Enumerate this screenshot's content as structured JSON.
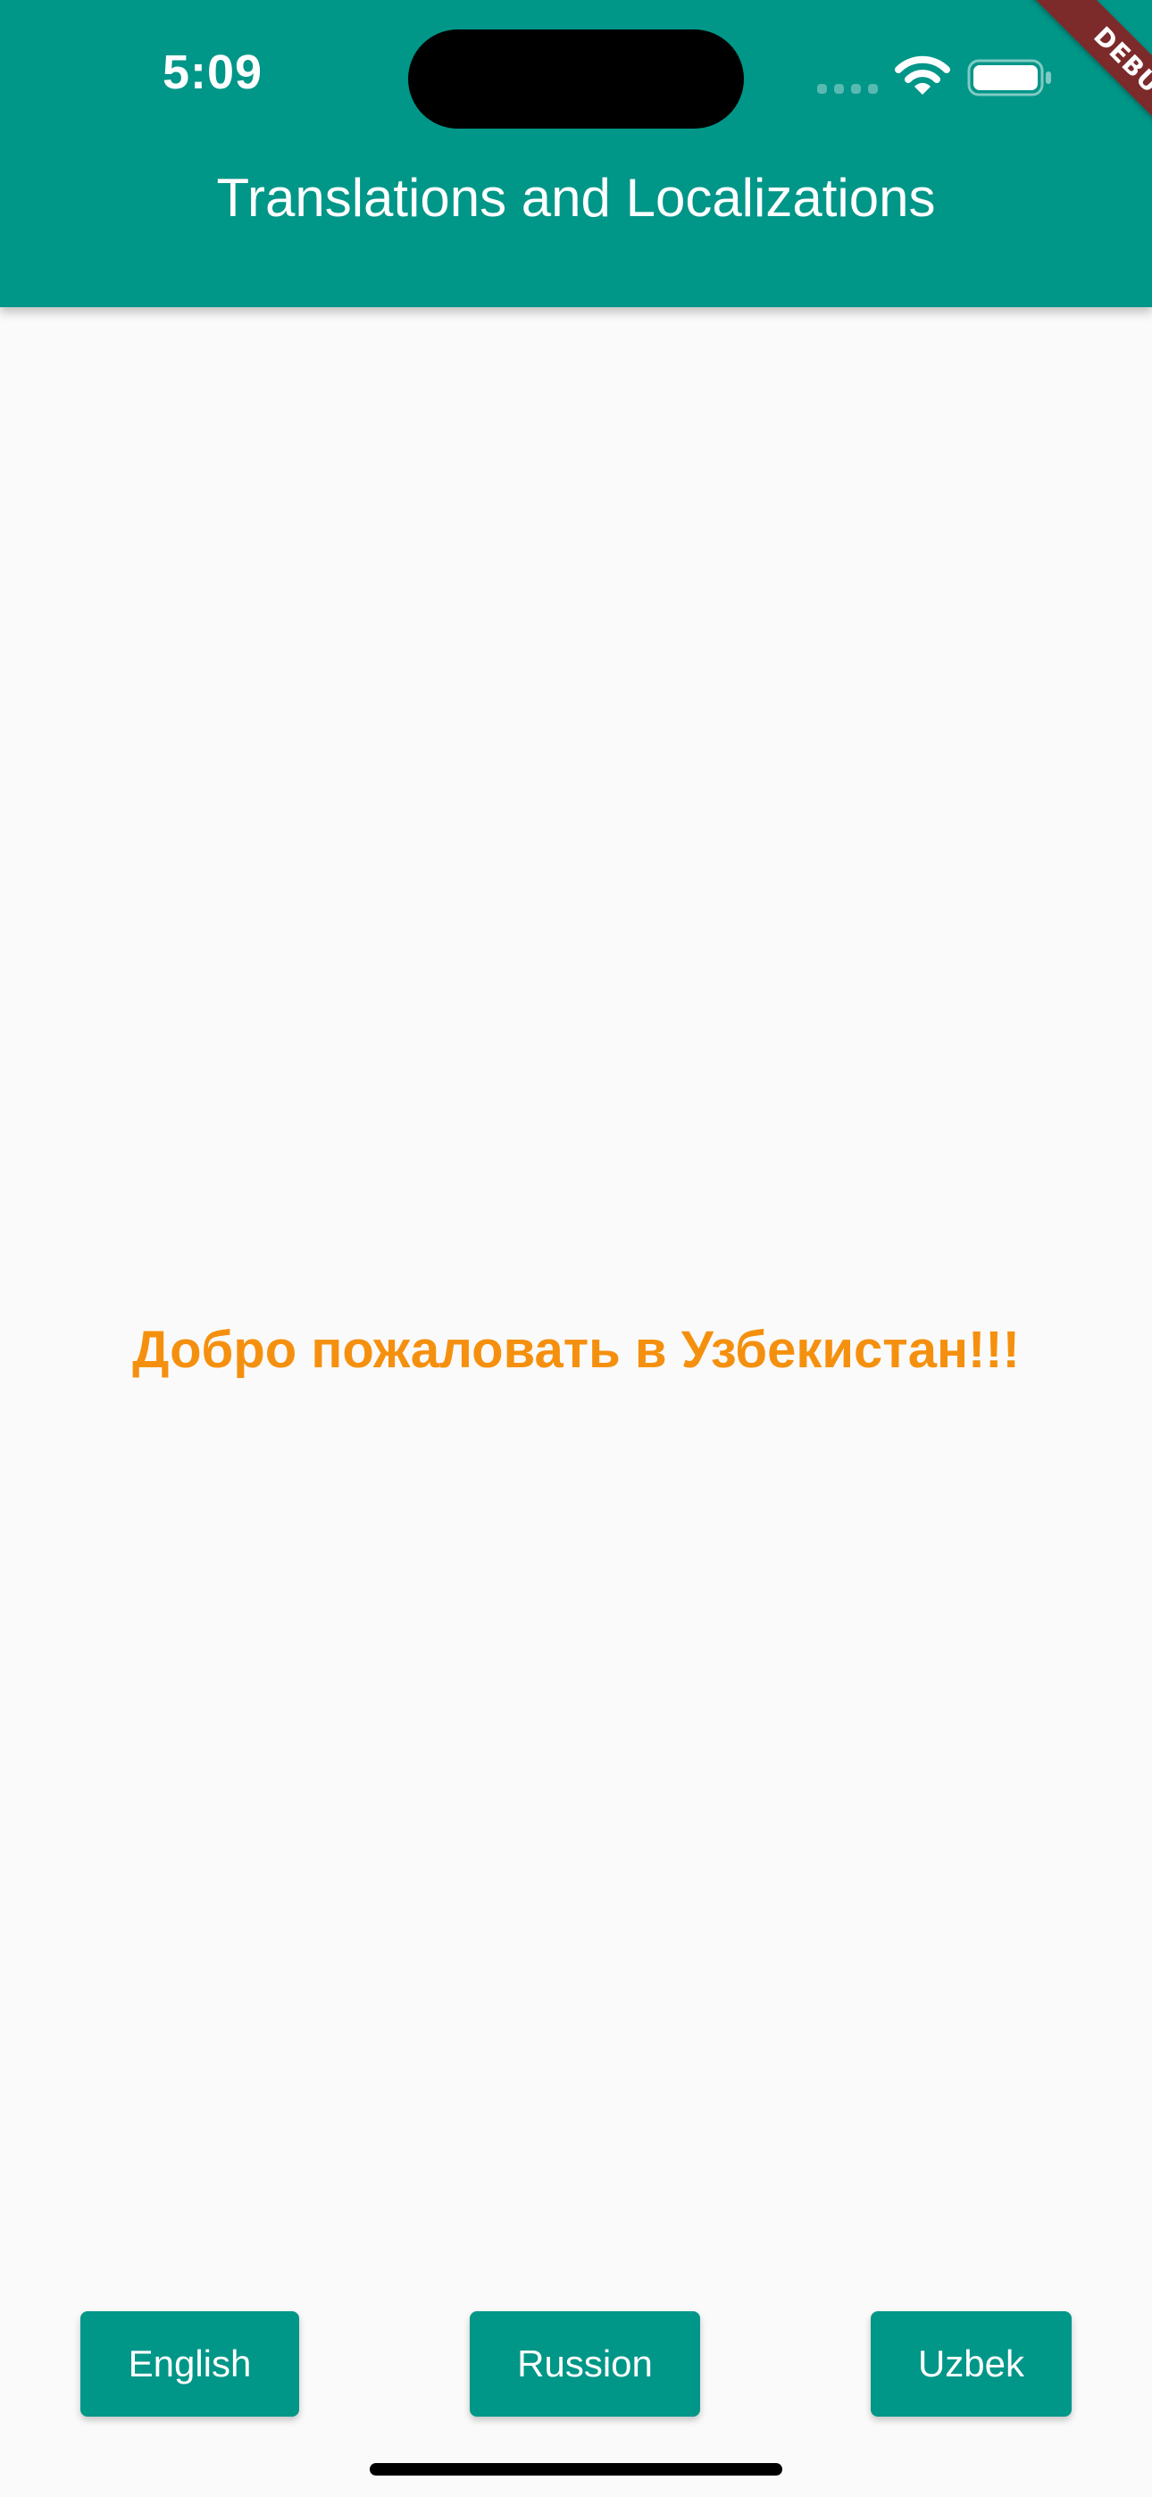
{
  "status_bar": {
    "time": "5:09"
  },
  "app_bar": {
    "title": "Translations and Localizations"
  },
  "debug_banner": {
    "label": "DEBUG"
  },
  "main": {
    "welcome_text": "Добро пожаловать в Узбекистан!!!"
  },
  "buttons": {
    "english_label": "English",
    "russion_label": "Russion",
    "uzbek_label": "Uzbek"
  },
  "colors": {
    "primary": "#009688",
    "accent_text": "#f5900f",
    "background": "#fafafa",
    "debug_ribbon": "#7d2a2a"
  }
}
